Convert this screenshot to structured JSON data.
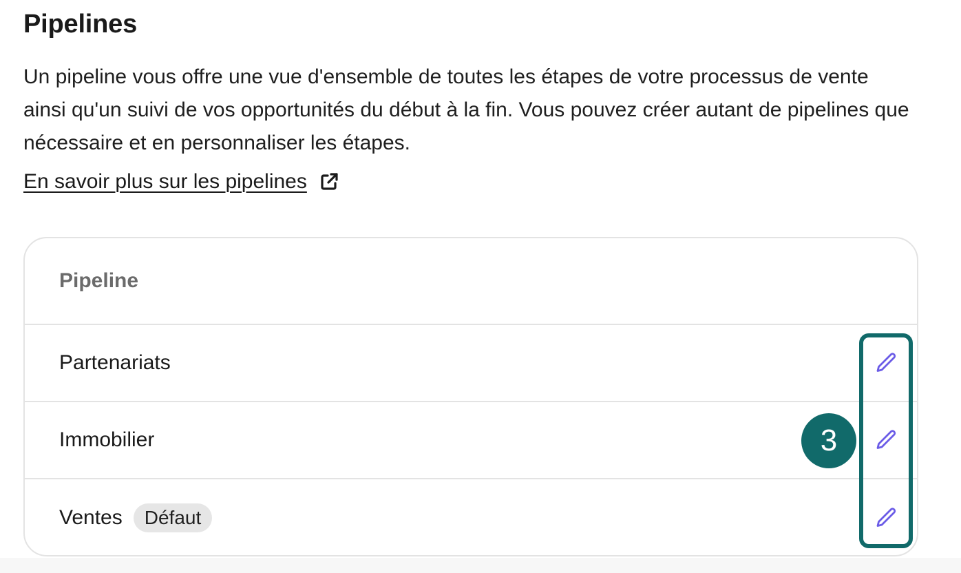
{
  "page": {
    "title": "Pipelines",
    "description": "Un pipeline vous offre une vue d'ensemble de toutes les étapes de votre processus de vente ainsi qu'un suivi de vos opportunités du début à la fin. Vous pouvez créer autant de pipelines que nécessaire et en personnaliser les étapes.",
    "learn_more": {
      "label": "En savoir plus sur les pipelines",
      "icon": "external-link-icon"
    }
  },
  "table": {
    "column_header": "Pipeline",
    "rows": [
      {
        "name": "Partenariats",
        "badge": "",
        "action_icon": "pencil-icon"
      },
      {
        "name": "Immobilier",
        "badge": "",
        "action_icon": "pencil-icon"
      },
      {
        "name": "Ventes",
        "badge": "Défaut",
        "action_icon": "pencil-icon"
      }
    ]
  },
  "annotation": {
    "step_number": "3"
  },
  "colors": {
    "accent_edit_icon": "#6b5ce7",
    "annotation_teal": "#116a6a",
    "border": "#e3e3e3",
    "badge_bg": "#e6e6e6"
  }
}
